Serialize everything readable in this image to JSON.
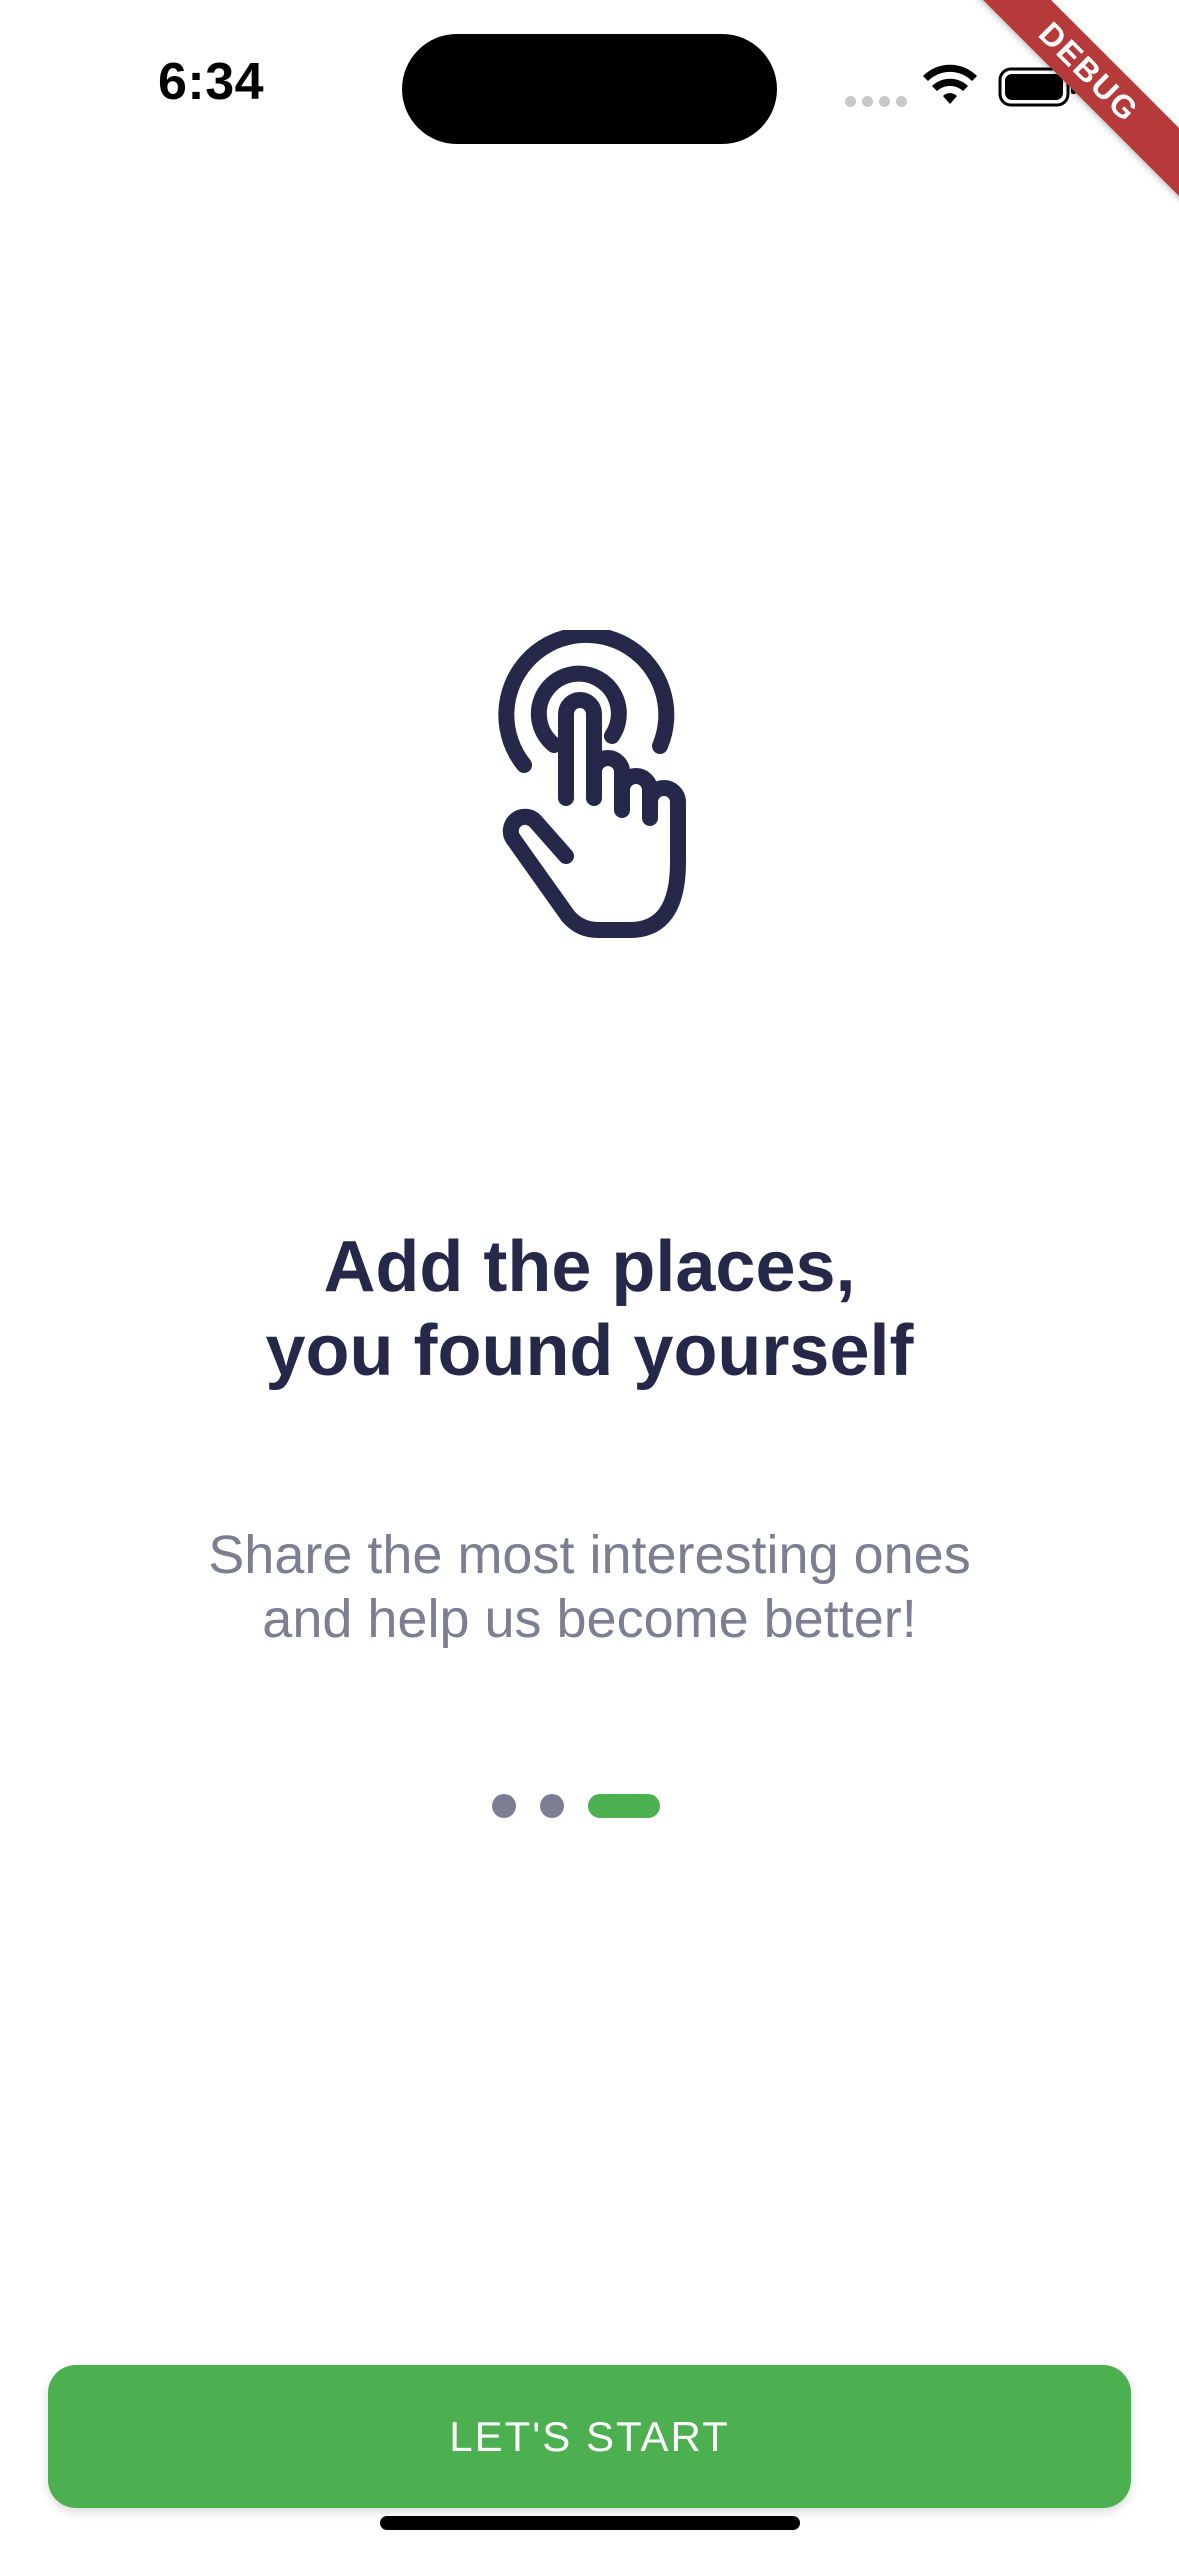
{
  "status_bar": {
    "time": "6:34",
    "icons": [
      "signal-dots-icon",
      "wifi-icon",
      "battery-icon"
    ]
  },
  "debug_banner": "DEBUG",
  "onboarding": {
    "illustration": "tap-hand-icon",
    "title_line1": "Add the places,",
    "title_line2": "you found yourself",
    "subtitle_line1": "Share the most interesting ones",
    "subtitle_line2": "and help us become better!",
    "page_indicator": {
      "total": 3,
      "current": 3
    }
  },
  "actions": {
    "start_label": "LET'S START"
  },
  "colors": {
    "primary": "#4caf50",
    "title": "#252849",
    "subtitle": "#7c7e92",
    "debug": "#b63a3a"
  }
}
